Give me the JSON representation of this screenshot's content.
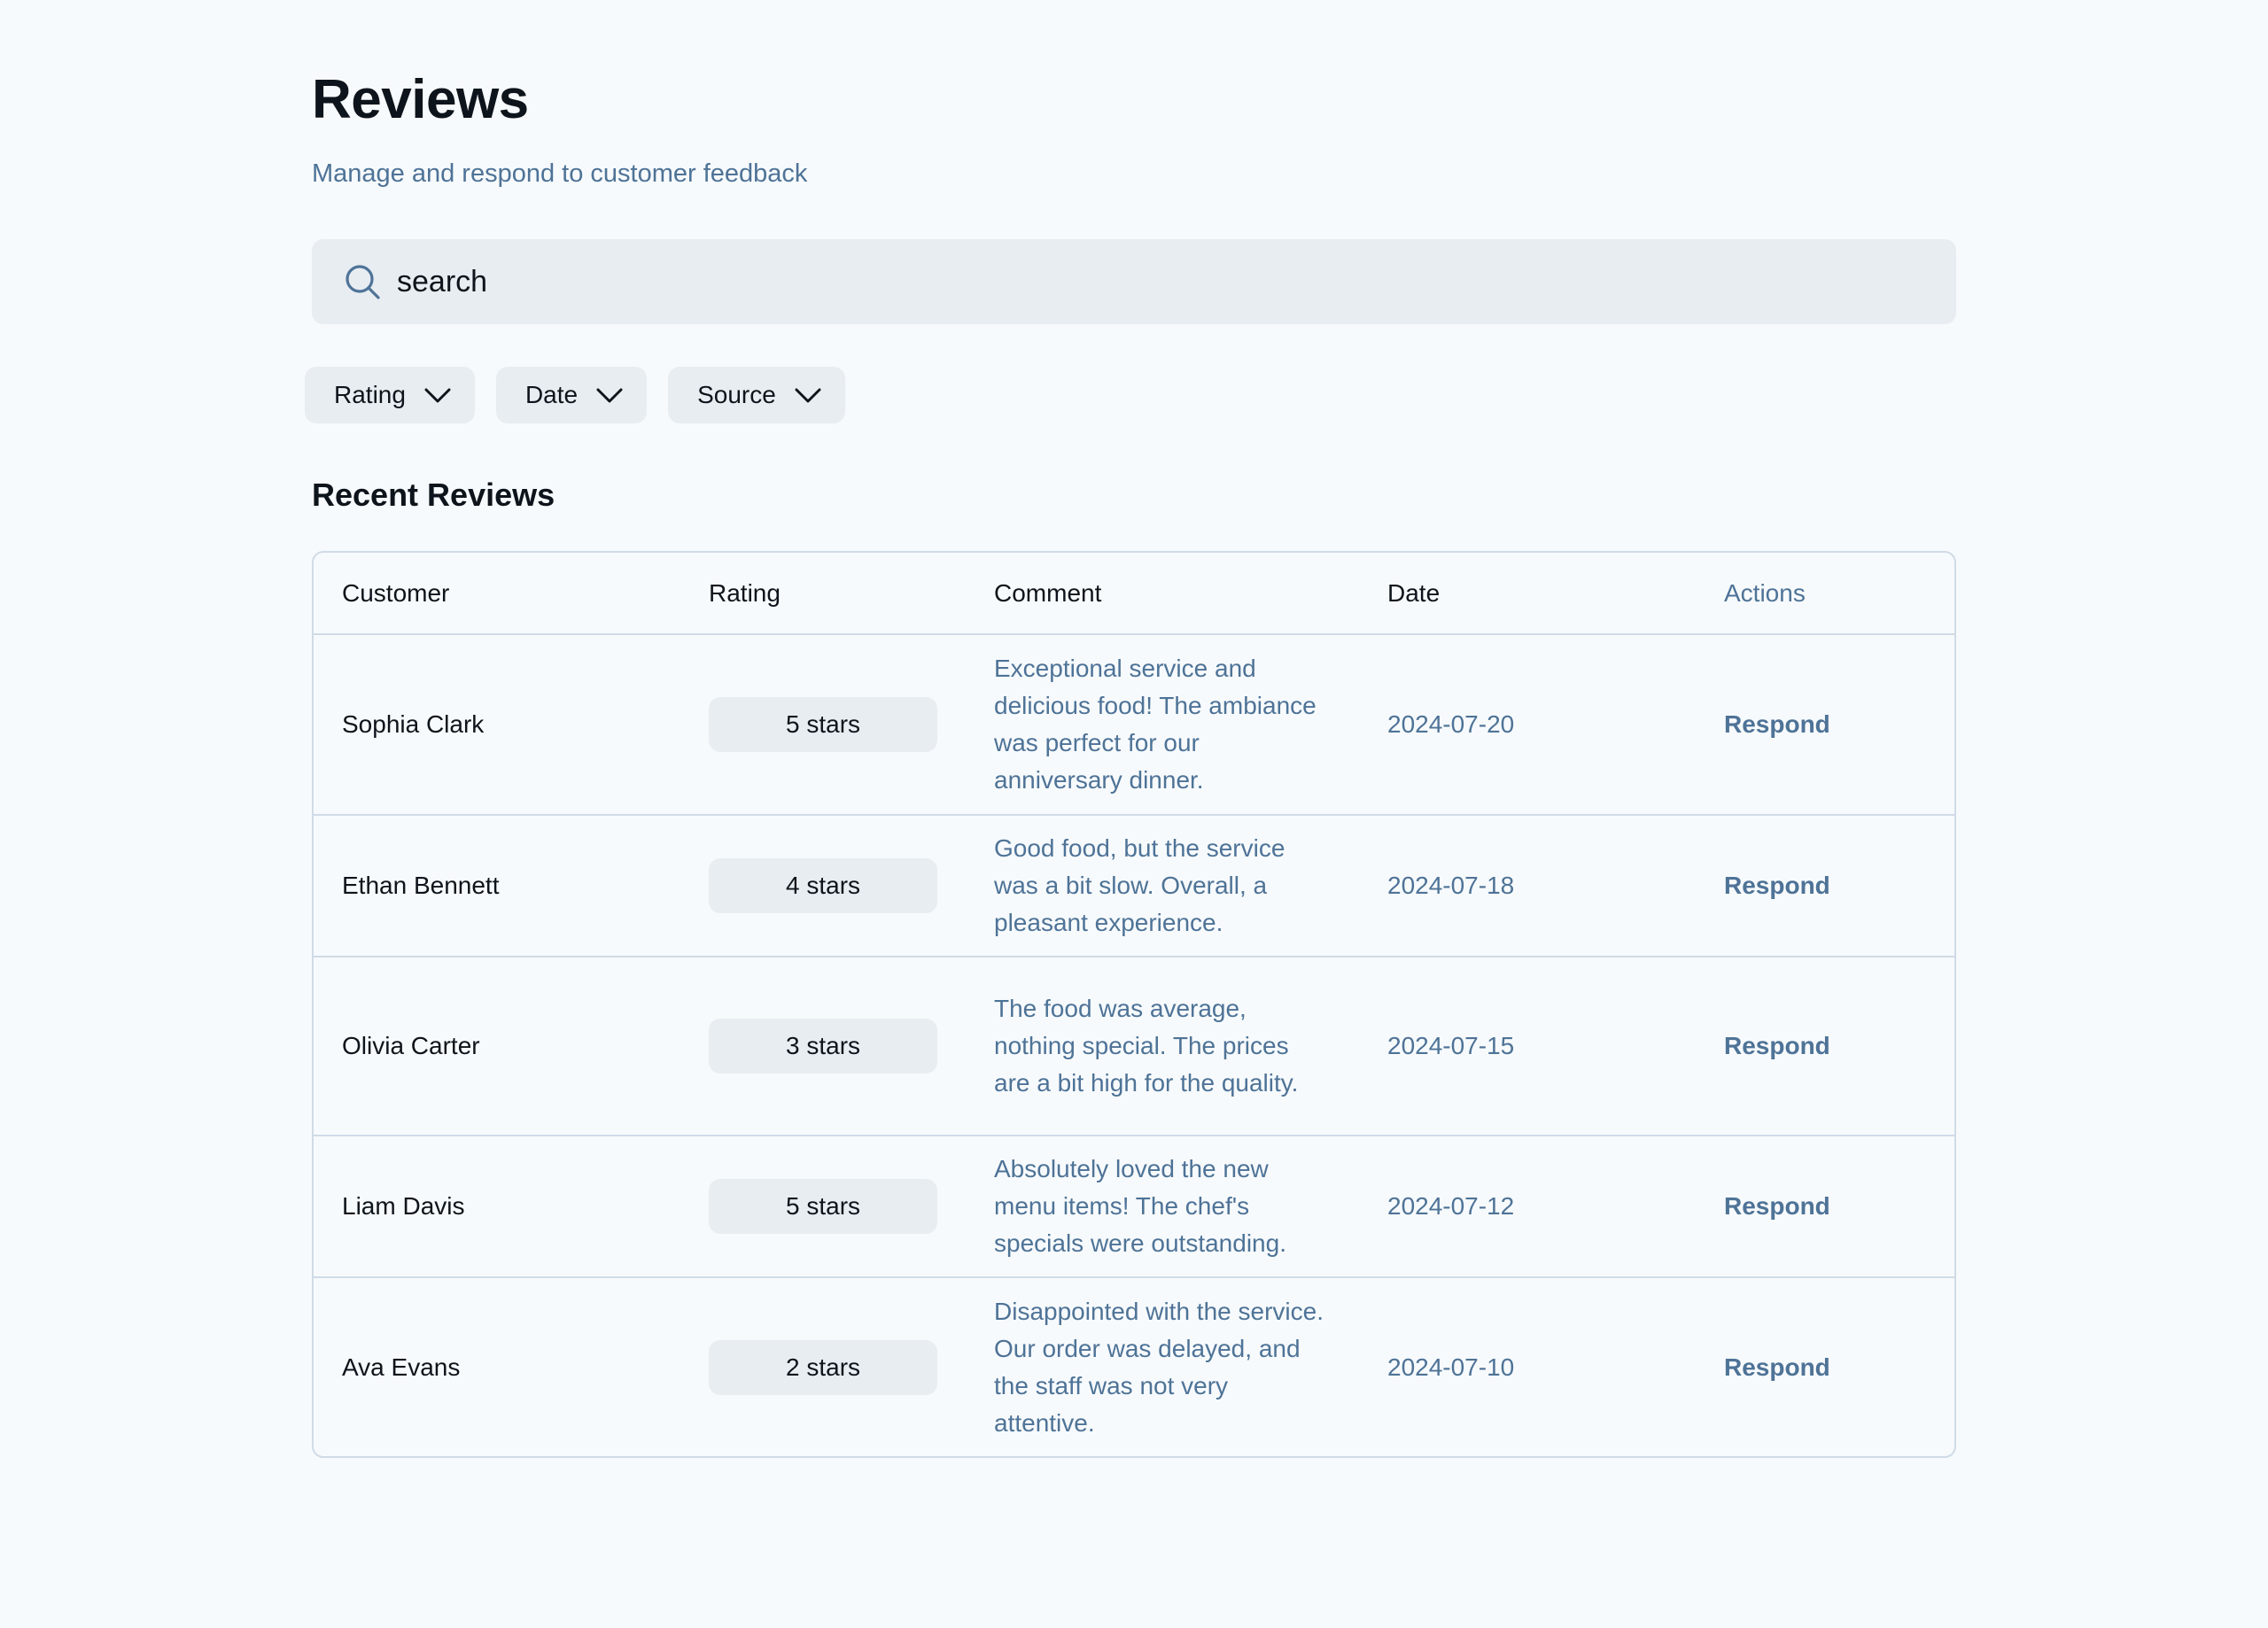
{
  "header": {
    "title": "Reviews",
    "subtitle": "Manage and respond to customer feedback"
  },
  "search": {
    "placeholder": "search",
    "icon": "search-icon"
  },
  "filters": [
    {
      "label": "Rating",
      "icon": "chevron-down-icon"
    },
    {
      "label": "Date",
      "icon": "chevron-down-icon"
    },
    {
      "label": "Source",
      "icon": "chevron-down-icon"
    }
  ],
  "section": {
    "title": "Recent Reviews"
  },
  "table": {
    "columns": [
      "Customer",
      "Rating",
      "Comment",
      "Date",
      "Actions"
    ],
    "rows": [
      {
        "customer": "Sophia Clark",
        "rating": "5 stars",
        "comment": "Exceptional service and delicious food! The ambiance was perfect for our anniversary dinner.",
        "date": "2024-07-20",
        "action": "Respond"
      },
      {
        "customer": "Ethan Bennett",
        "rating": "4 stars",
        "comment": "Good food, but the service was a bit slow. Overall, a pleasant experience.",
        "date": "2024-07-18",
        "action": "Respond"
      },
      {
        "customer": "Olivia Carter",
        "rating": "3 stars",
        "comment": "The food was average, nothing special. The prices are a bit high for the quality.",
        "date": "2024-07-15",
        "action": "Respond"
      },
      {
        "customer": "Liam Davis",
        "rating": "5 stars",
        "comment": "Absolutely loved the new menu items! The chef's specials were outstanding.",
        "date": "2024-07-12",
        "action": "Respond"
      },
      {
        "customer": "Ava Evans",
        "rating": "2 stars",
        "comment": "Disappointed with the service. Our order was delayed, and the staff was not very attentive.",
        "date": "2024-07-10",
        "action": "Respond"
      }
    ]
  },
  "colors": {
    "background": "#f7fafc",
    "surface": "#e8edf2",
    "border": "#d0dbe7",
    "text_primary": "#0e141b",
    "text_secondary": "#4e7397"
  }
}
